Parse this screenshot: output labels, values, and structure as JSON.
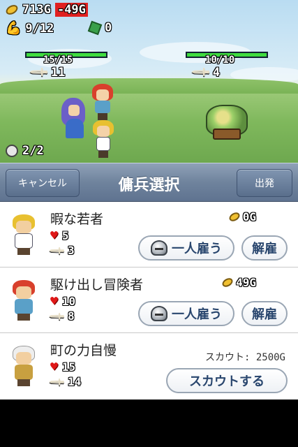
{
  "hud": {
    "gold": "713G",
    "gold_delta": "-49G",
    "party_count": "9/12",
    "gems": "0",
    "kills": "2/2"
  },
  "battle": {
    "ally_hp": "15/15",
    "ally_attack": "11",
    "enemy_hp": "10/10",
    "enemy_attack": "4"
  },
  "navbar": {
    "cancel_label": "キャンセル",
    "title": "傭兵選択",
    "depart_label": "出発"
  },
  "mercenaries": [
    {
      "name": "暇な若者",
      "hp": "5",
      "attack": "3",
      "price": "0G",
      "action": "一人雇う",
      "kaiko": "解雇",
      "hair_color": "#e8c030",
      "body_color": "#ffffff"
    },
    {
      "name": "駆け出し冒険者",
      "hp": "10",
      "attack": "8",
      "price": "49G",
      "action": "一人雇う",
      "kaiko": "解雇",
      "hair_color": "#d8402c",
      "body_color": "#5aa0c8"
    },
    {
      "name": "町の力自慢",
      "hp": "15",
      "attack": "14",
      "scout_text": "スカウト: 2500G",
      "action": "スカウトする",
      "hair_color": "#eeeeee",
      "body_color": "#c8a040"
    }
  ],
  "icons": {
    "coin": "coin-icon",
    "heart": "heart-icon",
    "sword": "sword-icon",
    "helmet": "helmet-icon",
    "arm": "arm-icon",
    "gem": "gem-icon",
    "skull": "skull-icon"
  }
}
